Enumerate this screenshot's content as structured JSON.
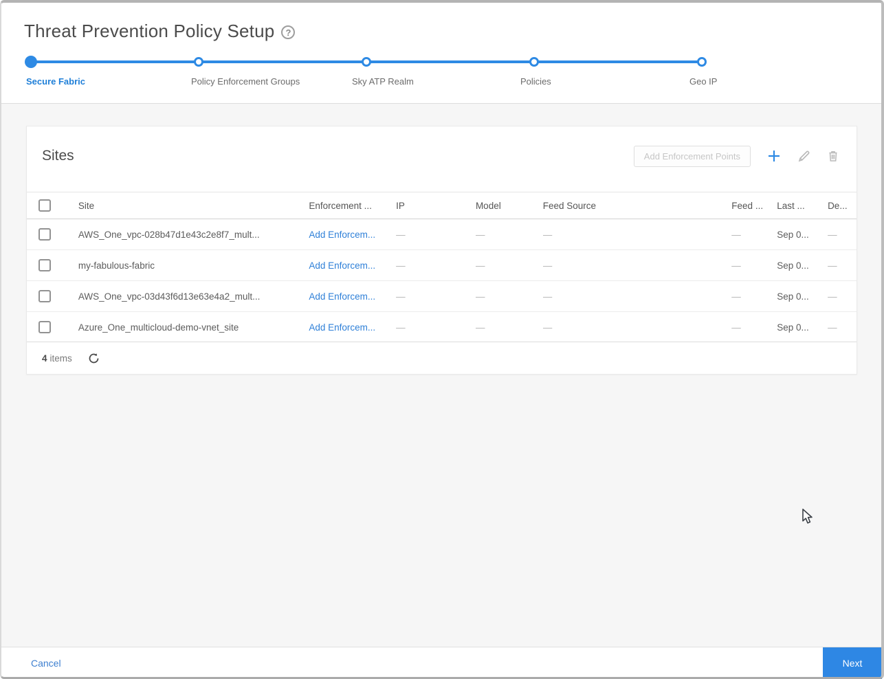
{
  "header": {
    "title": "Threat Prevention Policy Setup"
  },
  "stepper": {
    "steps": [
      {
        "label": "Secure Fabric",
        "state": "active"
      },
      {
        "label": "Policy Enforcement Groups",
        "state": "upcoming"
      },
      {
        "label": "Sky ATP Realm",
        "state": "upcoming"
      },
      {
        "label": "Policies",
        "state": "upcoming"
      },
      {
        "label": "Geo IP",
        "state": "upcoming"
      }
    ]
  },
  "panel": {
    "title": "Sites",
    "toolbar": {
      "add_enforcement_points_label": "Add Enforcement Points",
      "icons": [
        "add-icon",
        "edit-icon",
        "delete-icon"
      ]
    },
    "table": {
      "columns": [
        "Site",
        "Enforcement ...",
        "IP",
        "Model",
        "Feed Source",
        "Feed ...",
        "Last ...",
        "De..."
      ],
      "rows": [
        {
          "site": "AWS_One_vpc-028b47d1e43c2e8f7_mult...",
          "enforcement": "Add Enforcem...",
          "ip": "—",
          "model": "—",
          "feed_source": "—",
          "feed": "—",
          "last": "Sep 0...",
          "de": "—"
        },
        {
          "site": "my-fabulous-fabric",
          "enforcement": "Add Enforcem...",
          "ip": "—",
          "model": "—",
          "feed_source": "—",
          "feed": "—",
          "last": "Sep 0...",
          "de": "—"
        },
        {
          "site": "AWS_One_vpc-03d43f6d13e63e4a2_mult...",
          "enforcement": "Add Enforcem...",
          "ip": "—",
          "model": "—",
          "feed_source": "—",
          "feed": "—",
          "last": "Sep 0...",
          "de": "—"
        },
        {
          "site": "Azure_One_multicloud-demo-vnet_site",
          "enforcement": "Add Enforcem...",
          "ip": "—",
          "model": "—",
          "feed_source": "—",
          "feed": "—",
          "last": "Sep 0...",
          "de": "—"
        }
      ],
      "footer": {
        "count": "4",
        "count_label": "items"
      }
    }
  },
  "action_bar": {
    "cancel_label": "Cancel",
    "next_label": "Next"
  },
  "colors": {
    "accent_blue": "#2e8ae4",
    "link_blue": "#2f80d8",
    "active_step_blue": "#1f7fd8",
    "next_button_blue": "#2e87e4",
    "content_background": "#f6f6f6"
  },
  "misc": {
    "help_glyph": "?"
  }
}
